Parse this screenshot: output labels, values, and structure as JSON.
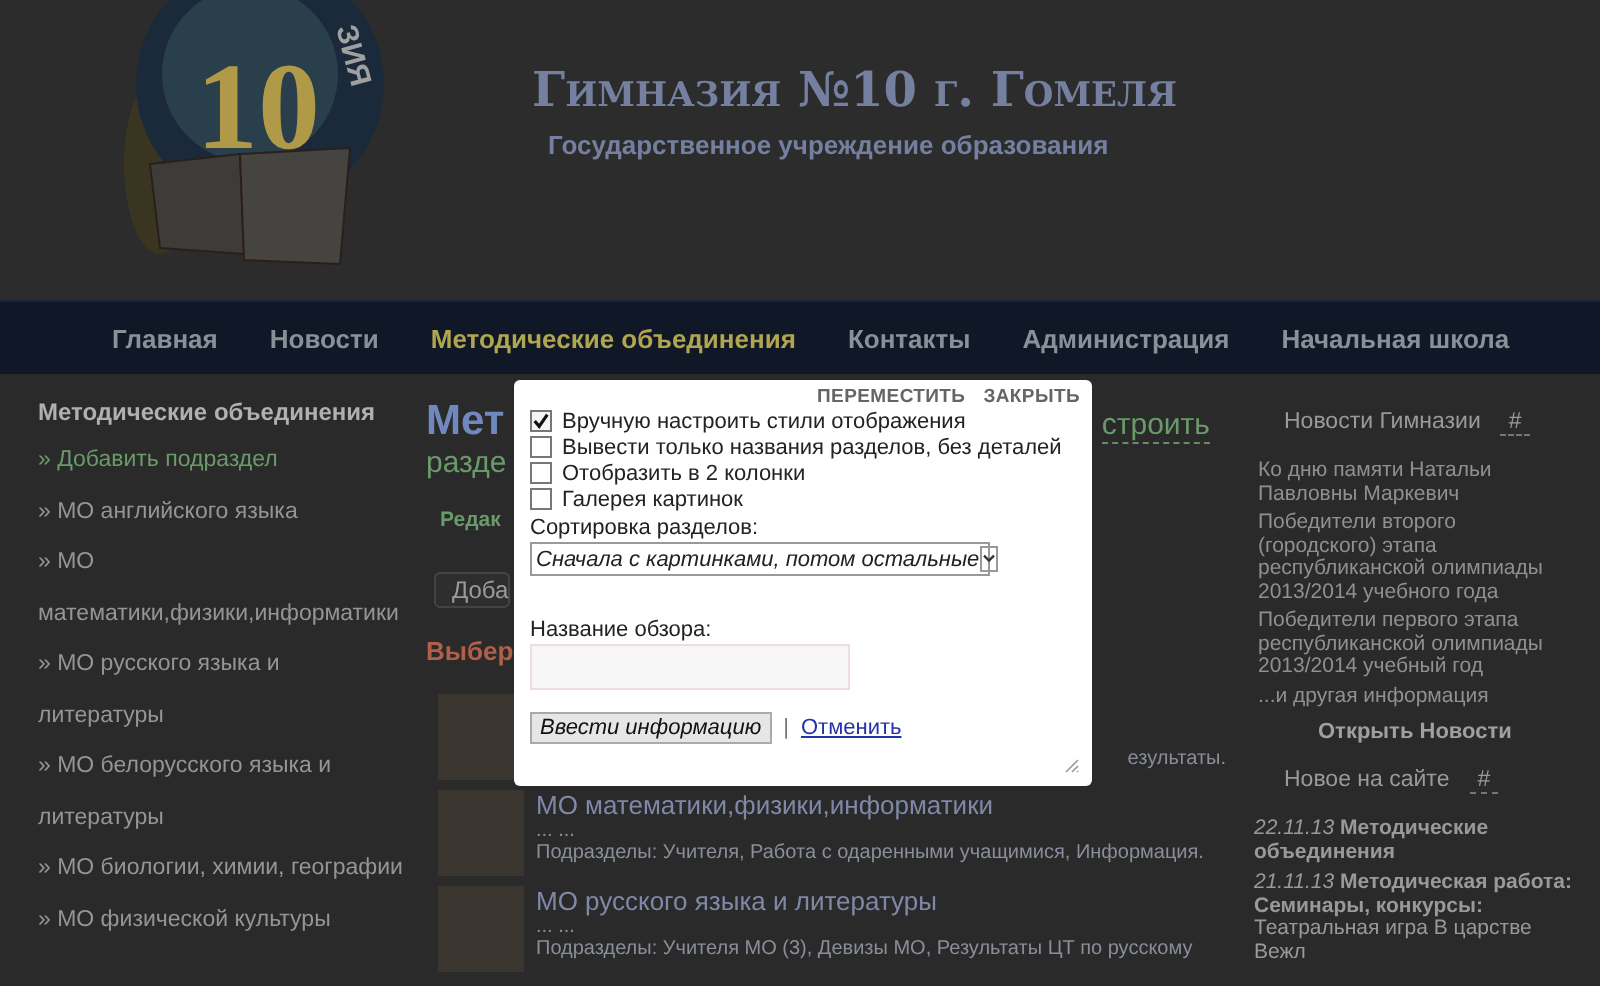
{
  "header": {
    "logo": {
      "number": "10",
      "arc_text": "ЗИЯ"
    },
    "title": "Гимназия №10 г. Гомеля",
    "subtitle": "Государственное учреждение образования"
  },
  "nav": [
    {
      "label": "Главная",
      "selected": false
    },
    {
      "label": "Новости",
      "selected": false
    },
    {
      "label": "Методические объединения",
      "selected": true
    },
    {
      "label": "Контакты",
      "selected": false
    },
    {
      "label": "Администрация",
      "selected": false
    },
    {
      "label": "Начальная школа",
      "selected": false
    }
  ],
  "sidebar": {
    "title": "Методические объединения",
    "items": [
      {
        "label": "» Добавить подраздел",
        "kind": "action"
      },
      {
        "label": "» МО английского языка",
        "kind": "link"
      },
      {
        "label": "» МО математики,физики,информатики",
        "kind": "link"
      },
      {
        "label": "» МО русского языка и литературы",
        "kind": "link"
      },
      {
        "label": "» МО белорусского языка и литературы",
        "kind": "link"
      },
      {
        "label": "» МО биологии, химии, географии",
        "kind": "link"
      },
      {
        "label": "» МО физической культуры",
        "kind": "link"
      }
    ]
  },
  "main": {
    "heading": "Мет",
    "configure_link": "строить",
    "subheading": "разде",
    "edit_link": "Редак",
    "add_button": "Доба",
    "choose_heading": "Выбер",
    "entries": [
      {
        "sections": "езультаты."
      },
      {
        "title": "МО математики,физики,информатики",
        "dots": "... ...",
        "sections": "Подразделы: Учителя, Работа с одаренными учащимися, Информация."
      },
      {
        "title": "МО русского языка и литературы",
        "dots": "... ...",
        "sections": "Подразделы: Учителя МО (3), Девизы МО, Результаты ЦТ по русскому"
      }
    ]
  },
  "right": {
    "news_title": "Новости Гимназии",
    "news_hash": "#",
    "news": [
      "Ко дню памяти Натальи Павловны Маркевич",
      "Победители второго (городского) этапа республиканской олимпиады 2013/2014 учебного года",
      "Победители первого этапа республиканской олимпиады 2013/2014 учебный год",
      "...и другая информация"
    ],
    "open_news": "Открыть Новости",
    "new_title": "Новое на сайте",
    "new_hash": "#",
    "updates": [
      "*22.11.13* **Методические объединения**",
      "*21.11.13* **Методическая работа: Семинары, конкурсы:** Театральная игра В царстве Вежл"
    ]
  },
  "dialog": {
    "move": "ПЕРЕМЕСТИТЬ",
    "close": "ЗАКРЫТЬ",
    "options": [
      {
        "label": "Вручную настроить стили отображения",
        "checked": true
      },
      {
        "label": "Вывести только названия разделов, без деталей",
        "checked": false
      },
      {
        "label": "Отобразить в 2 колонки",
        "checked": false
      },
      {
        "label": "Галерея картинок",
        "checked": false
      }
    ],
    "sort_label": "Сортировка разделов:",
    "sort_value": "Сначала с картинками, потом остальные",
    "name_label": "Название обзора:",
    "submit": "Ввести информацию",
    "separator": "|",
    "cancel": "Отменить"
  }
}
